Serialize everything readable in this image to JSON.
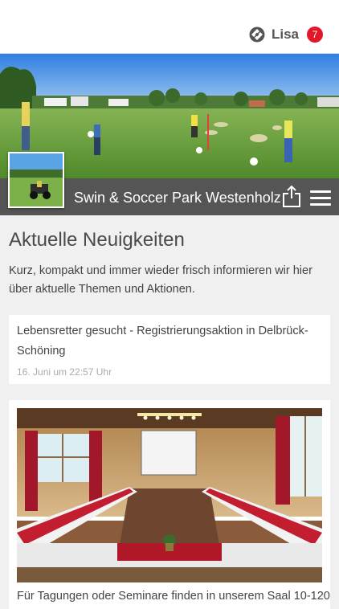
{
  "header": {
    "user_name": "Lisa",
    "notification_count": "7",
    "app_icon": "app-logo-icon"
  },
  "hero": {
    "club_name": "Swin & Soccer Park Westenholz",
    "share_icon": "share-icon",
    "menu_icon": "hamburger-menu-icon"
  },
  "news": {
    "title": "Aktuelle Neuigkeiten",
    "intro": "Kurz, kompakt und immer wieder frisch informieren wir hier über aktuelle Themen und Aktionen.",
    "items": [
      {
        "title": "Lebensretter gesucht - Registrierungsaktion in Delbrück-Schöning",
        "date": "16. Juni um 22:57 Uhr"
      },
      {
        "title": "Für Tagungen oder Seminare finden in unserem Saal 10-120"
      }
    ]
  },
  "colors": {
    "badge": "#e3172a",
    "hero_bar": "#484848",
    "background": "#f0f0f0"
  }
}
